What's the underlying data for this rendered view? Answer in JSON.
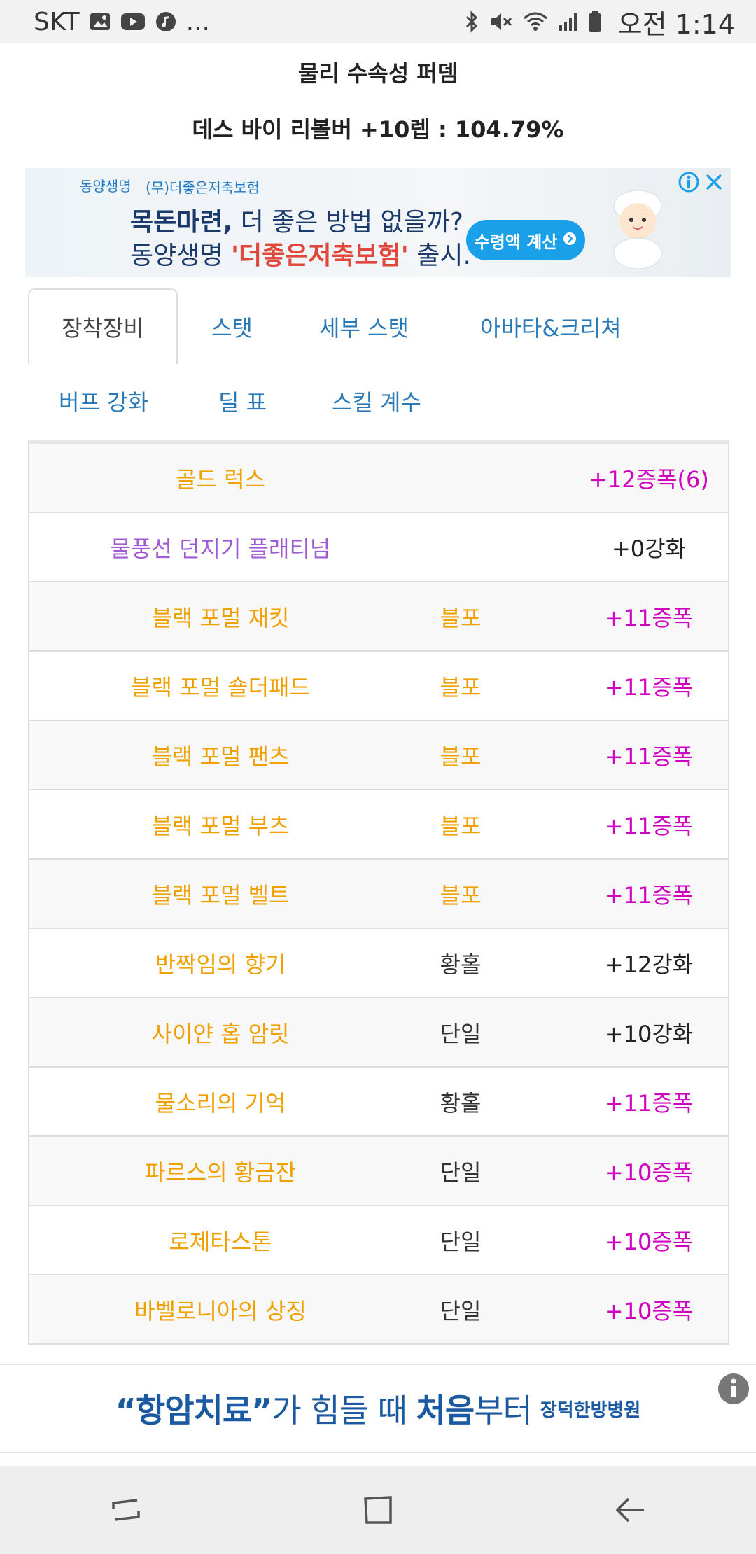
{
  "status_bar": {
    "carrier": "SKT",
    "extra": "...",
    "time": "오전 1:14",
    "icons_left": [
      "gallery-icon",
      "youtube-icon",
      "music-icon"
    ],
    "icons_right": [
      "bluetooth-icon",
      "mute-icon",
      "wifi-icon",
      "signal-icon",
      "battery-icon"
    ]
  },
  "header": {
    "title": "물리 수속성 퍼뎀",
    "subtitle": "데스 바이 리볼버 +10렙 : 104.79%"
  },
  "ad_top": {
    "brand_name": "동양생명",
    "brand_sub": "(무)더좋은저축보험",
    "line1_bold": "목돈마련,",
    "line1_rest": " 더 좋은 방법 없을까?",
    "line2_prefix": "동양생명 ",
    "line2_highlight": "'더좋은저축보험'",
    "line2_suffix": " 출시.",
    "cta": "수령액 계산",
    "colors": {
      "accent": "#1aa0e8",
      "highlight": "#e0483a",
      "text": "#1a3a6b"
    }
  },
  "tabs": {
    "row1": [
      {
        "label": "장착장비",
        "active": true
      },
      {
        "label": "스탯",
        "active": false
      },
      {
        "label": "세부 스탯",
        "active": false
      },
      {
        "label": "아바타&크리쳐",
        "active": false
      }
    ],
    "row2": [
      {
        "label": "버프 강화",
        "active": false
      },
      {
        "label": "딜 표",
        "active": false
      },
      {
        "label": "스킬 계수",
        "active": false
      }
    ]
  },
  "colors": {
    "epic": "#f0a000",
    "unique": "#a05ad6",
    "amplify": "#d000c0",
    "reinforce": "#222222",
    "tab_link": "#2a7ab8"
  },
  "equipment": [
    {
      "name": "골드 럭스",
      "type": "",
      "value": "+12증폭(6)",
      "name_color": "#f0a000",
      "value_color": "#d000c0"
    },
    {
      "name": "물풍선 던지기 플래티넘",
      "type": "",
      "value": "+0강화",
      "name_color": "#a05ad6",
      "value_color": "#222222"
    },
    {
      "name": "블랙 포멀 재킷",
      "type": "블포",
      "value": "+11증폭",
      "name_color": "#f0a000",
      "type_color": "#f0a000",
      "value_color": "#d000c0"
    },
    {
      "name": "블랙 포멀 숄더패드",
      "type": "블포",
      "value": "+11증폭",
      "name_color": "#f0a000",
      "type_color": "#f0a000",
      "value_color": "#d000c0"
    },
    {
      "name": "블랙 포멀 팬츠",
      "type": "블포",
      "value": "+11증폭",
      "name_color": "#f0a000",
      "type_color": "#f0a000",
      "value_color": "#d000c0"
    },
    {
      "name": "블랙 포멀 부츠",
      "type": "블포",
      "value": "+11증폭",
      "name_color": "#f0a000",
      "type_color": "#f0a000",
      "value_color": "#d000c0"
    },
    {
      "name": "블랙 포멀 벨트",
      "type": "블포",
      "value": "+11증폭",
      "name_color": "#f0a000",
      "type_color": "#f0a000",
      "value_color": "#d000c0"
    },
    {
      "name": "반짝임의 향기",
      "type": "황홀",
      "value": "+12강화",
      "name_color": "#f0a000",
      "type_color": "#333333",
      "value_color": "#222222"
    },
    {
      "name": "사이얀 홉 암릿",
      "type": "단일",
      "value": "+10강화",
      "name_color": "#f0a000",
      "type_color": "#333333",
      "value_color": "#222222"
    },
    {
      "name": "물소리의 기억",
      "type": "황홀",
      "value": "+11증폭",
      "name_color": "#f0a000",
      "type_color": "#333333",
      "value_color": "#d000c0"
    },
    {
      "name": "파르스의 황금잔",
      "type": "단일",
      "value": "+10증폭",
      "name_color": "#f0a000",
      "type_color": "#333333",
      "value_color": "#d000c0"
    },
    {
      "name": "로제타스톤",
      "type": "단일",
      "value": "+10증폭",
      "name_color": "#f0a000",
      "type_color": "#333333",
      "value_color": "#d000c0"
    },
    {
      "name": "바벨로니아의 상징",
      "type": "단일",
      "value": "+10증폭",
      "name_color": "#f0a000",
      "type_color": "#333333",
      "value_color": "#d000c0"
    }
  ],
  "ad_bottom": {
    "headline_bold": "“항암치료”",
    "headline_rest": "가 힘들 때 ",
    "headline_bold2": "처음",
    "headline_rest2": "부터",
    "sponsor": "장덕한방병원"
  },
  "nav": {
    "buttons": [
      "recents-icon",
      "home-icon",
      "back-icon"
    ]
  }
}
